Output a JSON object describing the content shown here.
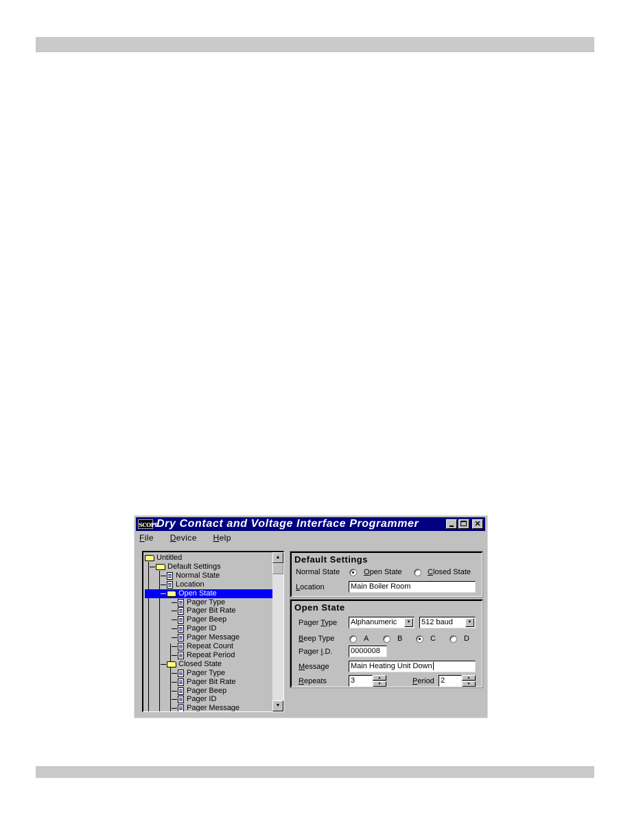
{
  "window": {
    "title": "Dry Contact and Voltage Interface Programmer",
    "app_icon_text": "SCOPE",
    "controls": {
      "minimize": "minimize",
      "maximize": "maximize",
      "close": "✕"
    }
  },
  "menu": {
    "items": [
      {
        "label": "File",
        "mnemonic": "F",
        "rest": "ile"
      },
      {
        "label": "Device",
        "mnemonic": "D",
        "rest": "evice"
      },
      {
        "label": "Help",
        "mnemonic": "H",
        "rest": "elp"
      }
    ]
  },
  "tree": {
    "items": [
      {
        "label": "Untitled",
        "icon": "folder-icon",
        "level": 0,
        "selected": false
      },
      {
        "label": "Default Settings",
        "icon": "folder-icon",
        "level": 1,
        "selected": false
      },
      {
        "label": "Normal State",
        "icon": "document-icon",
        "level": 2,
        "selected": false
      },
      {
        "label": "Location",
        "icon": "document-icon",
        "level": 2,
        "selected": false
      },
      {
        "label": "Open State",
        "icon": "folder-icon",
        "level": 2,
        "selected": true
      },
      {
        "label": "Pager Type",
        "icon": "document-icon",
        "level": 3,
        "selected": false
      },
      {
        "label": "Pager Bit Rate",
        "icon": "document-icon",
        "level": 3,
        "selected": false
      },
      {
        "label": "Pager Beep",
        "icon": "document-icon",
        "level": 3,
        "selected": false
      },
      {
        "label": "Pager ID",
        "icon": "document-icon",
        "level": 3,
        "selected": false
      },
      {
        "label": "Pager Message",
        "icon": "document-icon",
        "level": 3,
        "selected": false
      },
      {
        "label": "Repeat Count",
        "icon": "document-icon",
        "level": 3,
        "selected": false
      },
      {
        "label": "Repeat Period",
        "icon": "document-icon",
        "level": 3,
        "selected": false
      },
      {
        "label": "Closed State",
        "icon": "folder-icon",
        "level": 2,
        "selected": false
      },
      {
        "label": "Pager Type",
        "icon": "document-icon",
        "level": 3,
        "selected": false
      },
      {
        "label": "Pager Bit Rate",
        "icon": "document-icon",
        "level": 3,
        "selected": false
      },
      {
        "label": "Pager Beep",
        "icon": "document-icon",
        "level": 3,
        "selected": false
      },
      {
        "label": "Pager ID",
        "icon": "document-icon",
        "level": 3,
        "selected": false
      },
      {
        "label": "Pager Message",
        "icon": "document-icon",
        "level": 3,
        "selected": false
      }
    ],
    "scroll_up": "▲",
    "scroll_down": "▼"
  },
  "default_settings": {
    "title": "Default Settings",
    "normal_state_label": "Normal State",
    "options": [
      {
        "mnemonic": "O",
        "rest": "pen State",
        "checked": true
      },
      {
        "mnemonic": "C",
        "rest": "losed State",
        "checked": false
      }
    ],
    "location_label_mnemonic": "L",
    "location_label_rest": "ocation",
    "location_value": "Main Boiler Room"
  },
  "open_state": {
    "title": "Open State",
    "pager_type_label_pre": "Pager ",
    "pager_type_label_mnemonic": "T",
    "pager_type_label_rest": "ype",
    "pager_type_value": "Alphanumeric",
    "bit_rate_value": "512 baud",
    "beep_type_label_mnemonic": "B",
    "beep_type_label_rest": "eep Type",
    "beep_options": [
      {
        "label": "A",
        "checked": false
      },
      {
        "label": "B",
        "checked": false
      },
      {
        "label": "C",
        "checked": true
      },
      {
        "label": "D",
        "checked": false
      }
    ],
    "pager_id_label_pre": "Pager ",
    "pager_id_label_mnemonic": "I",
    "pager_id_label_rest": ".D.",
    "pager_id_value": "0000008",
    "message_label_mnemonic": "M",
    "message_label_rest": "essage",
    "message_value": "Main Heating Unit Down",
    "repeats_label_mnemonic": "R",
    "repeats_label_rest": "epeats",
    "repeats_value": "3",
    "period_label_mnemonic": "P",
    "period_label_rest": "eriod",
    "period_value": "2",
    "dropdown_glyph": "▼",
    "spin_up": "▲",
    "spin_down": "▼"
  },
  "colors": {
    "titlebar": "#000080",
    "selection": "#0000ff",
    "face": "#c0c0c0",
    "page_bar": "#cacaca"
  }
}
